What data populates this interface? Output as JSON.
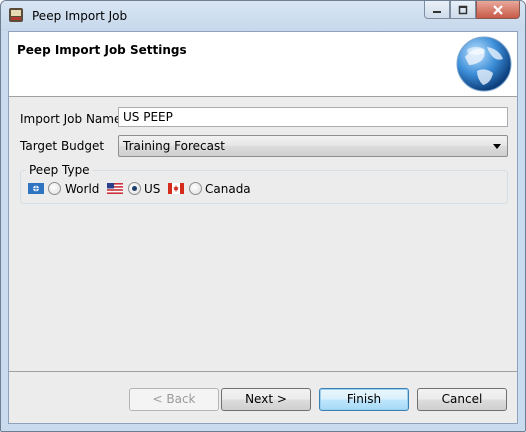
{
  "window": {
    "title": "Peep Import Job",
    "icons": {
      "app": "app-icon",
      "minimize": "minimize-icon",
      "maximize": "maximize-icon",
      "close": "close-icon"
    }
  },
  "header": {
    "title": "Peep Import Job Settings",
    "image": "globe-icon"
  },
  "form": {
    "import_job_name": {
      "label": "Import Job Name",
      "value": "US PEEP"
    },
    "target_budget": {
      "label": "Target Budget",
      "selected": "Training Forecast"
    }
  },
  "peep_type": {
    "legend": "Peep Type",
    "options": [
      {
        "label": "World",
        "flag": "world-flag-icon",
        "checked": false
      },
      {
        "label": "US",
        "flag": "us-flag-icon",
        "checked": true
      },
      {
        "label": "Canada",
        "flag": "canada-flag-icon",
        "checked": false
      }
    ]
  },
  "buttons": {
    "back": "< Back",
    "next": "Next >",
    "finish": "Finish",
    "cancel": "Cancel"
  },
  "colors": {
    "frame": "#c9dbee",
    "dialog_bg": "#ececec",
    "header_bg": "#ffffff",
    "default_button": "#bee6fd",
    "close_button": "#c85a48"
  }
}
